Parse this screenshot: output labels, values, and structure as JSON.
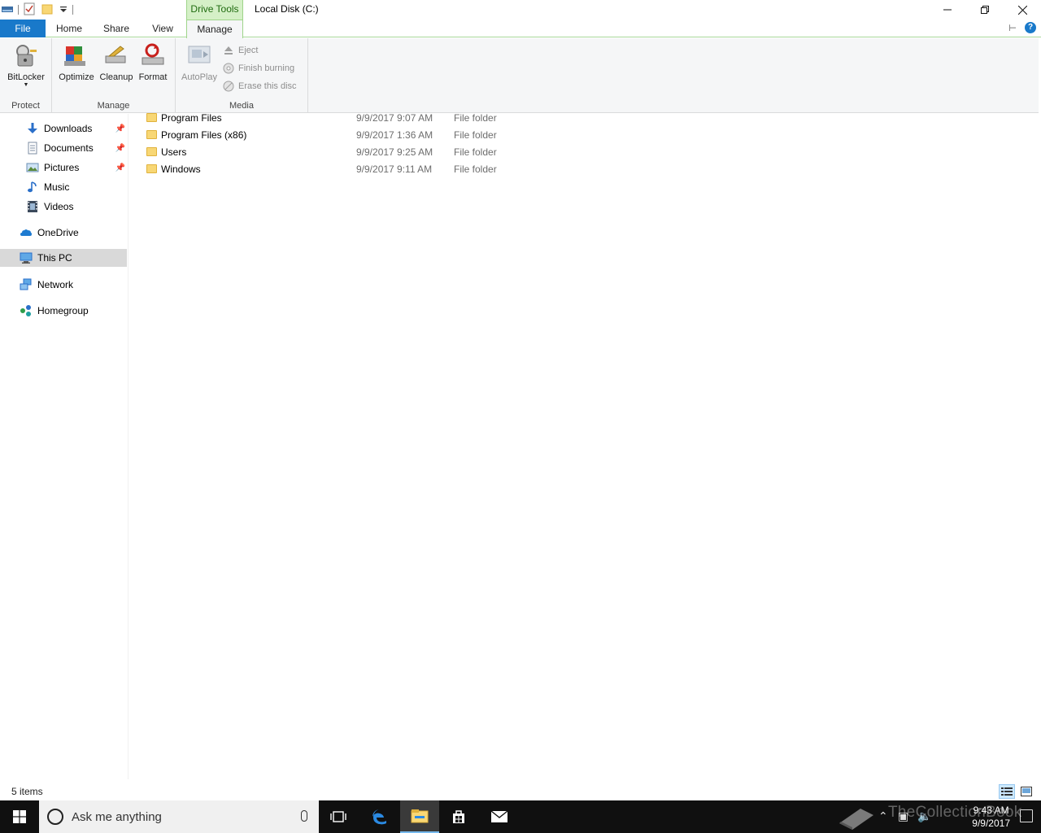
{
  "window": {
    "title": "Local Disk (C:)",
    "context_tab_group": "Drive Tools"
  },
  "tabs": {
    "file": "File",
    "home": "Home",
    "share": "Share",
    "view": "View",
    "manage": "Manage"
  },
  "ribbon": {
    "protect": {
      "label": "Protect",
      "bitlocker": "BitLocker"
    },
    "manage": {
      "label": "Manage",
      "optimize": "Optimize",
      "cleanup": "Cleanup",
      "format": "Format"
    },
    "media": {
      "label": "Media",
      "autoplay": "AutoPlay",
      "eject": "Eject",
      "finish_burning": "Finish burning",
      "erase_disc": "Erase this disc"
    }
  },
  "nav": {
    "items": [
      {
        "label": "Downloads",
        "icon": "download-icon",
        "pinned": true
      },
      {
        "label": "Documents",
        "icon": "documents-icon",
        "pinned": true
      },
      {
        "label": "Pictures",
        "icon": "pictures-icon",
        "pinned": true
      },
      {
        "label": "Music",
        "icon": "music-icon",
        "pinned": false
      },
      {
        "label": "Videos",
        "icon": "videos-icon",
        "pinned": false
      },
      {
        "label": "OneDrive",
        "icon": "onedrive-icon",
        "pinned": false
      },
      {
        "label": "This PC",
        "icon": "this-pc-icon",
        "pinned": false,
        "selected": true
      },
      {
        "label": "Network",
        "icon": "network-icon",
        "pinned": false
      },
      {
        "label": "Homegroup",
        "icon": "homegroup-icon",
        "pinned": false
      }
    ]
  },
  "files": [
    {
      "name": "Program Files",
      "date": "9/9/2017 9:07 AM",
      "type": "File folder"
    },
    {
      "name": "Program Files (x86)",
      "date": "9/9/2017 1:36 AM",
      "type": "File folder"
    },
    {
      "name": "Users",
      "date": "9/9/2017 9:25 AM",
      "type": "File folder"
    },
    {
      "name": "Windows",
      "date": "9/9/2017 9:11 AM",
      "type": "File folder"
    }
  ],
  "status": {
    "item_count": "5 items"
  },
  "taskbar": {
    "search_placeholder": "Ask me anything",
    "time": "9:43 AM",
    "date": "9/9/2017",
    "watermark": "TheCollectionBook"
  },
  "colors": {
    "accent": "#1979ca",
    "context_tab": "#d5f0c7",
    "folder": "#f8d775",
    "taskbar": "#101010"
  }
}
